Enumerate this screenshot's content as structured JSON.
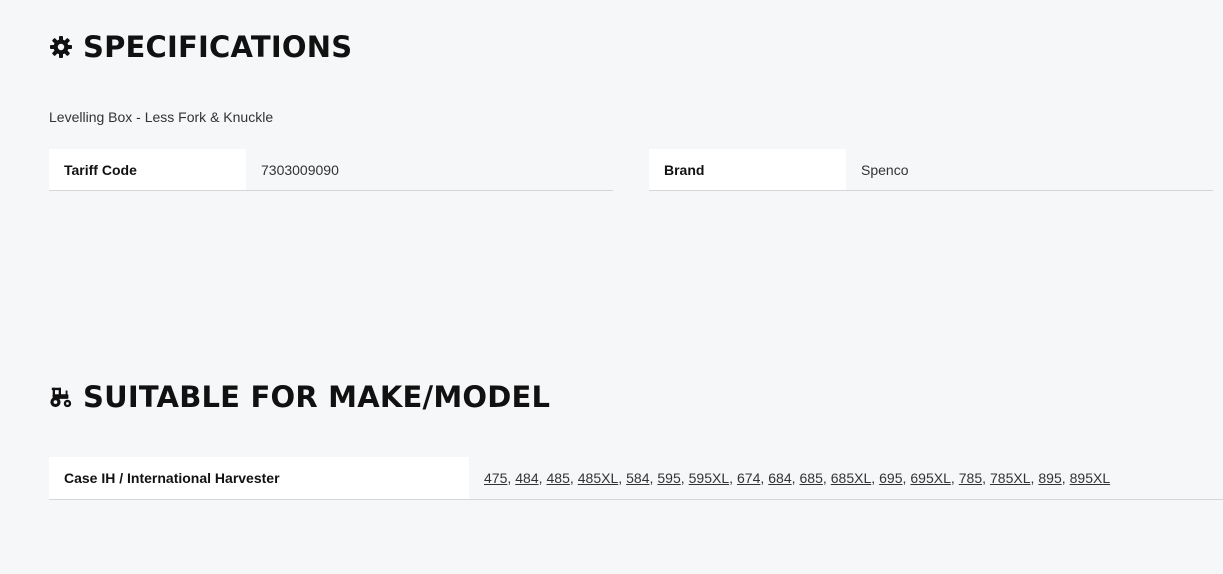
{
  "specifications": {
    "heading": "SPECIFICATIONS",
    "icon": "gear-icon",
    "description": "Levelling Box - Less Fork & Knuckle",
    "rows": [
      {
        "label": "Tariff Code",
        "value": "7303009090"
      },
      {
        "label": "Brand",
        "value": "Spenco"
      }
    ]
  },
  "suitable_for": {
    "heading": "SUITABLE FOR MAKE/MODEL",
    "icon": "tractor-icon",
    "make": "Case IH / International Harvester",
    "models": [
      "475",
      "484",
      "485",
      "485XL",
      "584",
      "595",
      "595XL",
      "674",
      "684",
      "685",
      "685XL",
      "695",
      "695XL",
      "785",
      "785XL",
      "895",
      "895XL"
    ]
  }
}
